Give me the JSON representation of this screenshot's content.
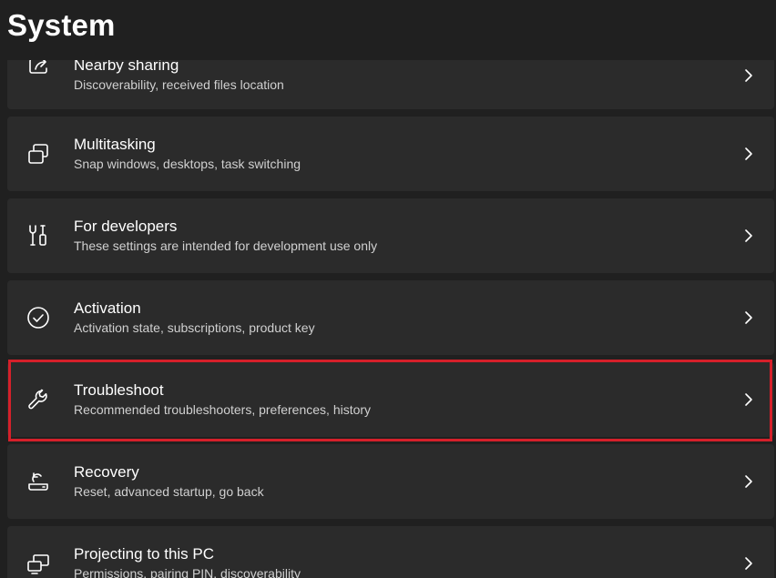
{
  "header": {
    "title": "System"
  },
  "items": [
    {
      "label": "Nearby sharing",
      "description": "Discoverability, received files location",
      "icon": "share-icon"
    },
    {
      "label": "Multitasking",
      "description": "Snap windows, desktops, task switching",
      "icon": "multitasking-icon"
    },
    {
      "label": "For developers",
      "description": "These settings are intended for development use only",
      "icon": "developer-tools-icon"
    },
    {
      "label": "Activation",
      "description": "Activation state, subscriptions, product key",
      "icon": "checkmark-circle-icon"
    },
    {
      "label": "Troubleshoot",
      "description": "Recommended troubleshooters, preferences, history",
      "icon": "wrench-icon",
      "highlighted": true
    },
    {
      "label": "Recovery",
      "description": "Reset, advanced startup, go back",
      "icon": "recovery-icon"
    },
    {
      "label": "Projecting to this PC",
      "description": "Permissions, pairing PIN, discoverability",
      "icon": "projecting-icon"
    }
  ],
  "colors": {
    "background": "#202020",
    "card": "#2b2b2b",
    "highlight_border": "#d5202a",
    "description_text": "#d0d0d0"
  }
}
